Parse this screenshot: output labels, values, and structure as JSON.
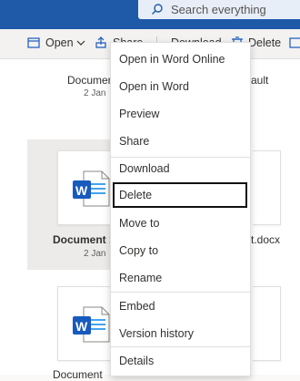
{
  "search": {
    "placeholder": "Search everything"
  },
  "commandbar": {
    "open_label": "Open",
    "share_label": "Share",
    "download_label": "Download",
    "delete_label": "Delete"
  },
  "tiles": [
    {
      "label": "Document",
      "date": "2 Jan"
    },
    {
      "label": "Document 1.",
      "date": "2 Jan"
    },
    {
      "label": "Document",
      "date": "2 Jan"
    }
  ],
  "right_tiles": [
    {
      "label": "ault"
    },
    {
      "label": "t.docx"
    }
  ],
  "icon_letter": "W",
  "context_menu": {
    "items": [
      {
        "label": "Open in Word Online"
      },
      {
        "label": "Open in Word"
      },
      {
        "label": "Preview"
      },
      {
        "label": "Share"
      },
      {
        "label": "Download"
      },
      {
        "label": "Delete",
        "focused": true
      },
      {
        "label": "Move to"
      },
      {
        "label": "Copy to"
      },
      {
        "label": "Rename"
      },
      {
        "label": "Embed"
      },
      {
        "label": "Version history"
      },
      {
        "label": "Details"
      }
    ]
  },
  "colors": {
    "brand_blue": "#1f5aa8",
    "word_blue": "#185abd",
    "word_light": "#41a5ee"
  },
  "icons": [
    "search-icon",
    "open-icon",
    "share-icon",
    "delete-icon",
    "word-file-icon"
  ]
}
